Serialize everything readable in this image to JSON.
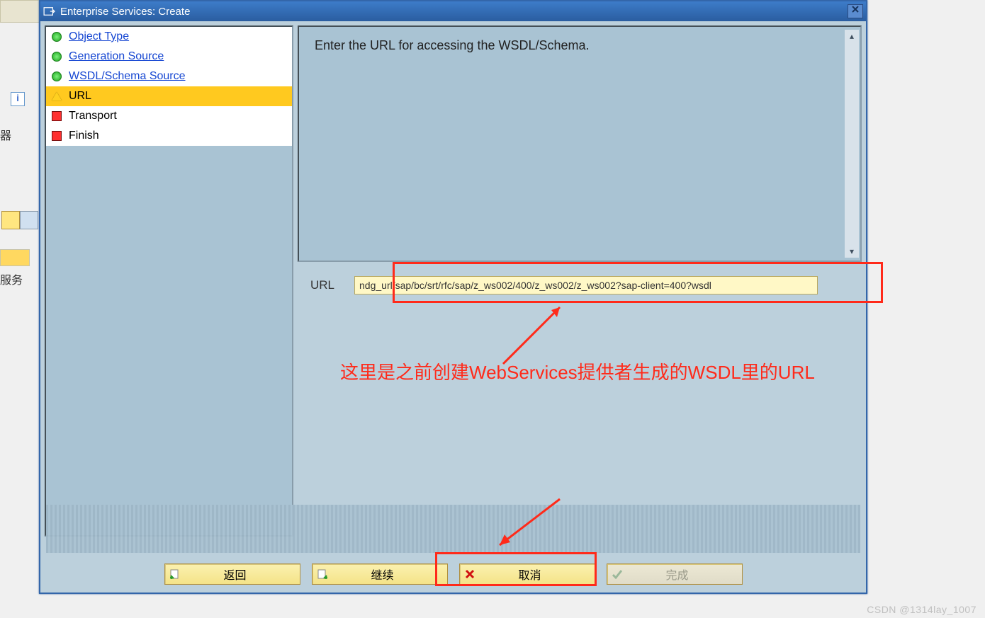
{
  "bg": {
    "label": "器",
    "label2": "服务",
    "info": "i"
  },
  "dialog": {
    "title": "Enterprise Services: Create",
    "close": "✕"
  },
  "nav": {
    "items": [
      {
        "icon": "green",
        "label": "Object Type",
        "link": true
      },
      {
        "icon": "green",
        "label": "Generation Source",
        "link": true
      },
      {
        "icon": "green",
        "label": "WSDL/Schema Source",
        "link": true
      },
      {
        "icon": "tri",
        "label": "URL",
        "link": false,
        "active": true
      },
      {
        "icon": "sq",
        "label": "Transport",
        "link": false
      },
      {
        "icon": "sq",
        "label": "Finish",
        "link": false
      }
    ]
  },
  "instruction": "Enter the URL for accessing the WSDL/Schema.",
  "form": {
    "url_label": "URL",
    "url_value": "ndg_url/sap/bc/srt/rfc/sap/z_ws002/400/z_ws002/z_ws002?sap-client=400?wsdl"
  },
  "annotation": {
    "text": "这里是之前创建WebServices提供者生成的WSDL里的URL"
  },
  "buttons": {
    "back": "返回",
    "continue": "继续",
    "cancel": "取消",
    "finish": "完成"
  },
  "watermark": "CSDN @1314lay_1007"
}
